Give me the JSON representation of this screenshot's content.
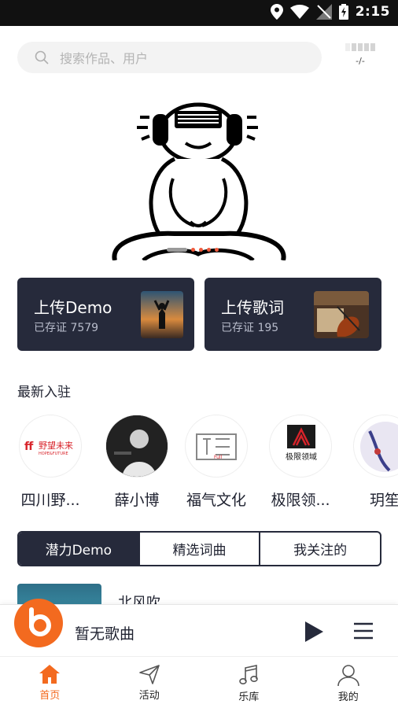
{
  "status_bar": {
    "time": "2:15"
  },
  "search": {
    "placeholder": "搜索作品、用户"
  },
  "signal": {
    "value": "-/-"
  },
  "banner": {
    "pages": 6,
    "active_page": 1
  },
  "cards": [
    {
      "title": "上传Demo",
      "subtitle": "已存证 7579"
    },
    {
      "title": "上传歌词",
      "subtitle": "已存证 195"
    }
  ],
  "new_artists": {
    "title": "最新入驻",
    "items": [
      {
        "name": "四川野...",
        "logo_text": "野望未来",
        "logo_sub": "HOPE&FUTURE"
      },
      {
        "name": "薛小博"
      },
      {
        "name": "福气文化",
        "logo_text": "福气"
      },
      {
        "name": "极限领...",
        "logo_text": "极限领域"
      },
      {
        "name": "玥笙"
      }
    ]
  },
  "tabs": [
    {
      "label": "潜力Demo",
      "active": true
    },
    {
      "label": "精选词曲",
      "active": false
    },
    {
      "label": "我关注的",
      "active": false
    }
  ],
  "list_preview": {
    "title": "北风吹"
  },
  "player": {
    "title": "暂无歌曲"
  },
  "nav": [
    {
      "label": "首页",
      "active": true,
      "icon": "home-icon"
    },
    {
      "label": "活动",
      "active": false,
      "icon": "send-icon"
    },
    {
      "label": "乐库",
      "active": false,
      "icon": "music-note-icon"
    },
    {
      "label": "我的",
      "active": false,
      "icon": "user-icon"
    }
  ],
  "colors": {
    "accent": "#f36a1f",
    "dark": "#262a3b",
    "dot": "#f05a3c"
  }
}
